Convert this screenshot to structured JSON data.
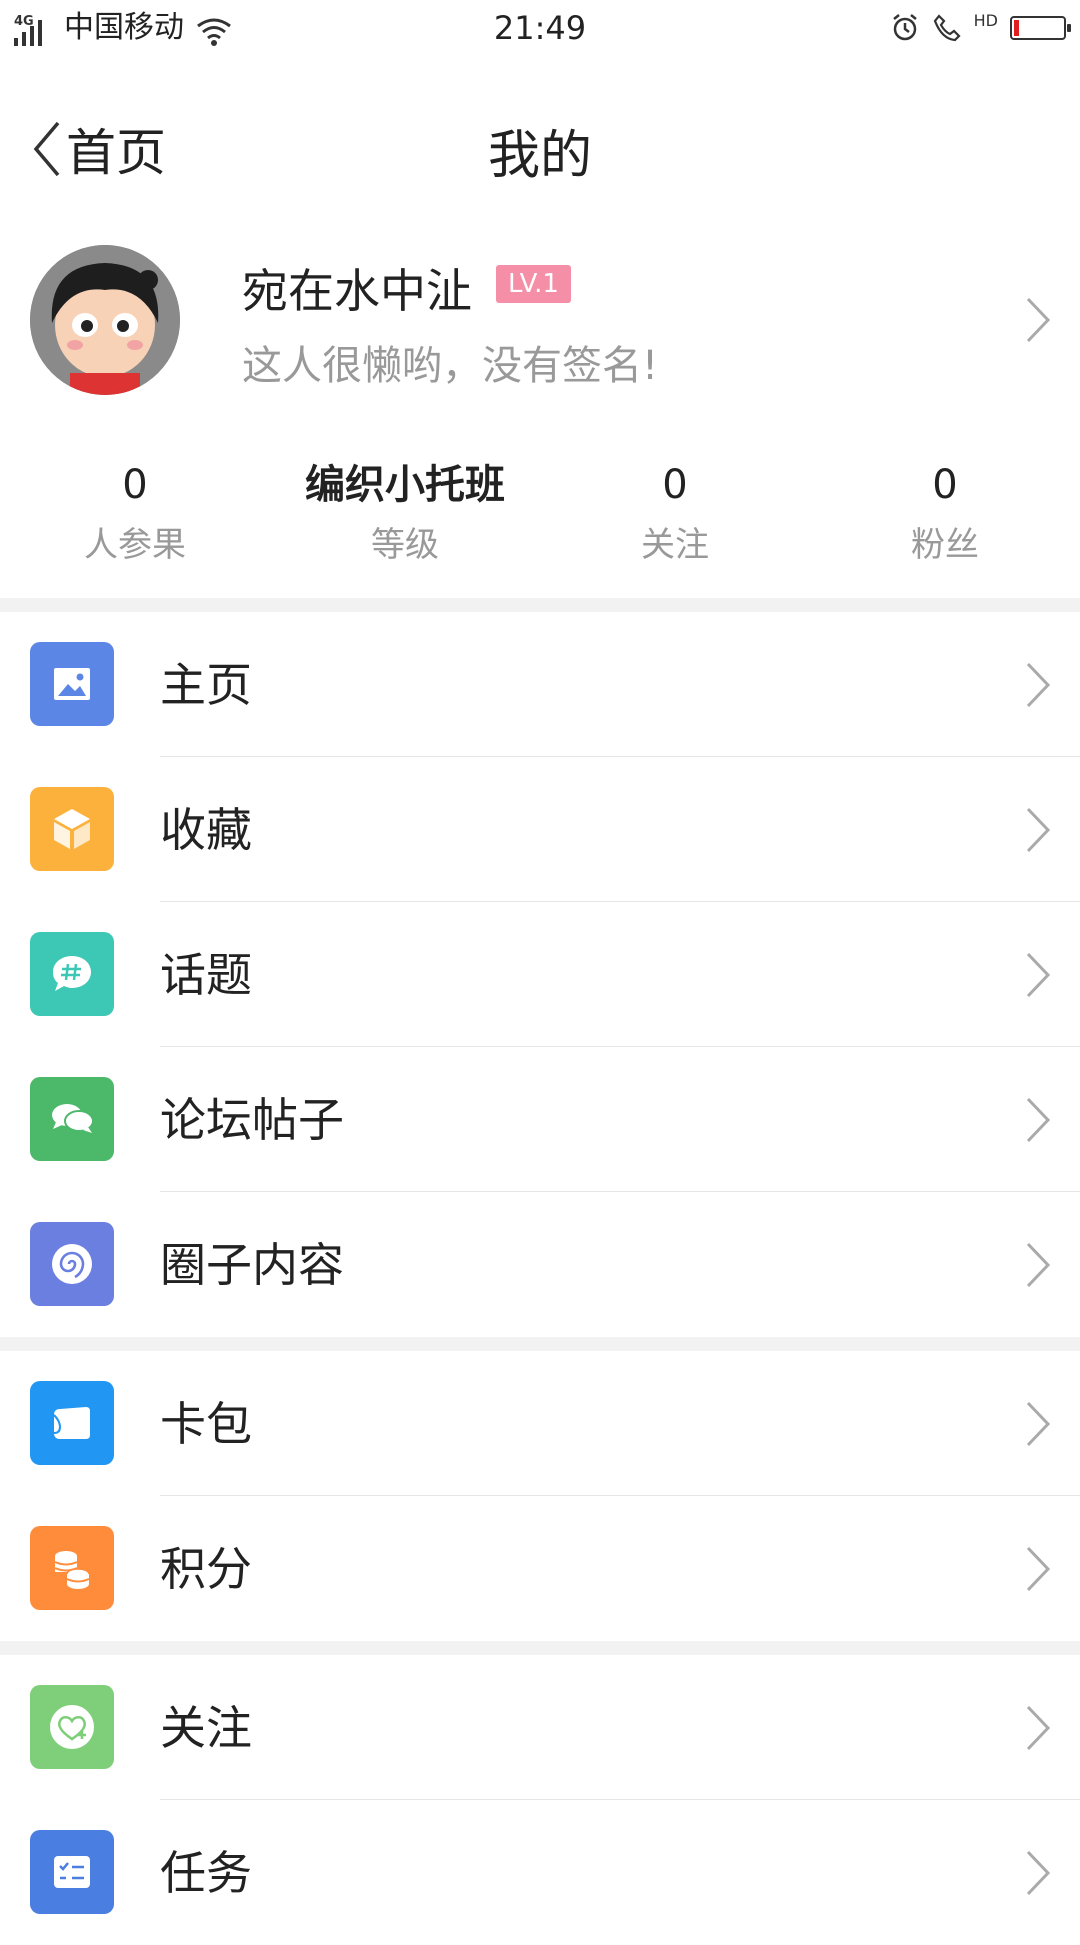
{
  "status_bar": {
    "network": "4G",
    "carrier": "中国移动",
    "time": "21:49",
    "hd_label": "HD",
    "battery_level_percent": 10,
    "battery_color": "#e02020"
  },
  "header": {
    "back_label": "首页",
    "title": "我的"
  },
  "profile": {
    "username": "宛在水中沚",
    "level_badge": "LV.1",
    "signature": "这人很懒哟，没有签名!"
  },
  "stats": [
    {
      "value": "0",
      "label": "人参果"
    },
    {
      "value": "编织小托班",
      "label": "等级"
    },
    {
      "value": "0",
      "label": "关注"
    },
    {
      "value": "0",
      "label": "粉丝"
    }
  ],
  "menu_groups": [
    [
      {
        "label": "主页",
        "icon": "picture-icon",
        "color": "#5b86e5"
      },
      {
        "label": "收藏",
        "icon": "box-icon",
        "color": "#fbb13c"
      },
      {
        "label": "话题",
        "icon": "hashtag-bubble-icon",
        "color": "#3cc8b4"
      },
      {
        "label": "论坛帖子",
        "icon": "chat-bubbles-icon",
        "color": "#4cb86a"
      },
      {
        "label": "圈子内容",
        "icon": "spiral-icon",
        "color": "#6a7fe0"
      }
    ],
    [
      {
        "label": "卡包",
        "icon": "card-icon",
        "color": "#2196f3"
      },
      {
        "label": "积分",
        "icon": "coins-icon",
        "color": "#ff8c3a"
      }
    ],
    [
      {
        "label": "关注",
        "icon": "heart-plus-icon",
        "color": "#7fcf7a"
      },
      {
        "label": "任务",
        "icon": "task-list-icon",
        "color": "#4a7ee0"
      }
    ]
  ]
}
